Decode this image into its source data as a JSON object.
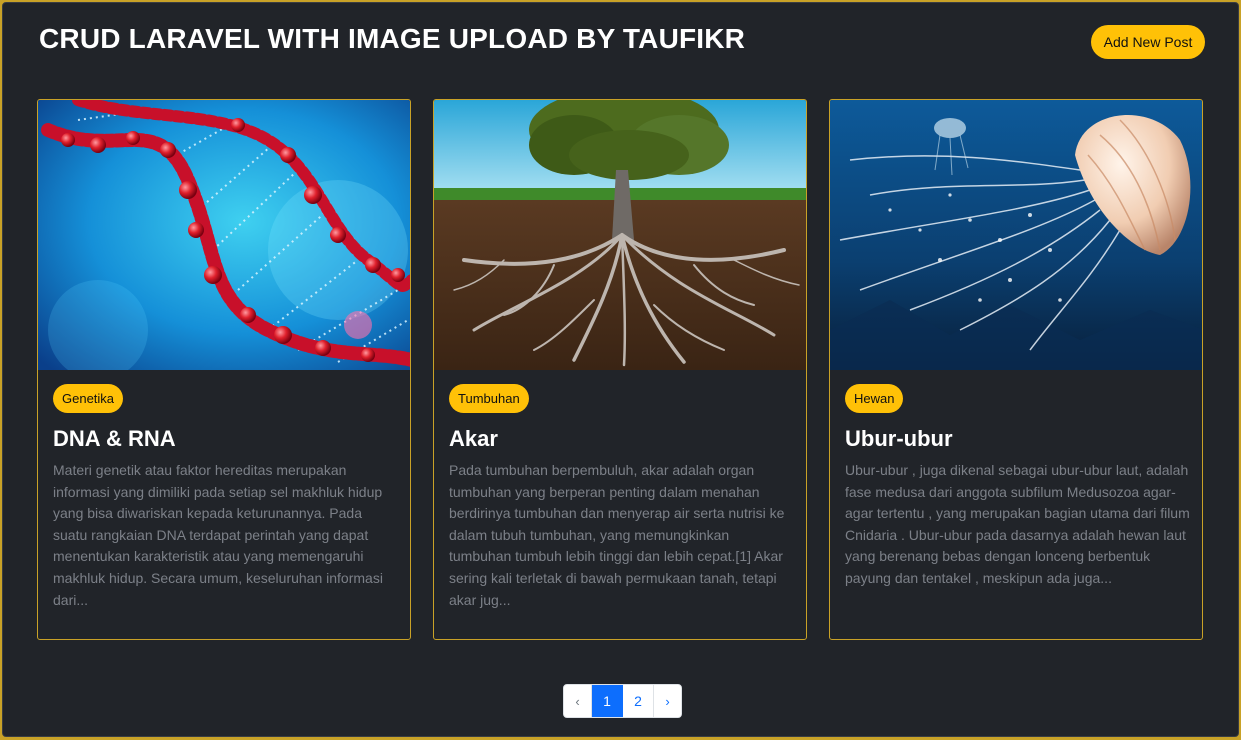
{
  "header": {
    "title": "CRUD LARAVEL WITH IMAGE UPLOAD BY TAUFIKR",
    "add_button": "Add New Post"
  },
  "posts": [
    {
      "category": "Genetika",
      "title": "DNA & RNA",
      "excerpt": "Materi genetik atau faktor hereditas merupakan informasi yang dimiliki pada setiap sel makhluk hidup yang bisa diwariskan kepada keturunannya. Pada suatu rangkaian DNA terdapat perintah yang dapat menentukan karakteristik atau yang memengaruhi makhluk hidup. Secara umum, keseluruhan informasi dari...",
      "image": "dna-helix-image"
    },
    {
      "category": "Tumbuhan",
      "title": "Akar",
      "excerpt": "Pada tumbuhan berpembuluh, akar adalah organ tumbuhan yang berperan penting dalam menahan berdirinya tumbuhan dan menyerap air serta nutrisi ke dalam tubuh tumbuhan, yang memungkinkan tumbuhan tumbuh lebih tinggi dan lebih cepat.[1] Akar sering kali terletak di bawah permukaan tanah, tetapi akar jug...",
      "image": "tree-roots-image"
    },
    {
      "category": "Hewan",
      "title": "Ubur-ubur",
      "excerpt": "Ubur-ubur , juga dikenal sebagai ubur-ubur laut, adalah fase medusa dari anggota subfilum Medusozoa agar-agar tertentu , yang merupakan bagian utama dari filum Cnidaria . Ubur-ubur pada dasarnya adalah hewan laut yang berenang bebas dengan lonceng berbentuk payung dan tentakel , meskipun ada juga...",
      "image": "jellyfish-image"
    }
  ],
  "pagination": {
    "prev": "‹",
    "pages": [
      "1",
      "2"
    ],
    "active": "1",
    "next": "›"
  },
  "colors": {
    "accent": "#ffc107",
    "background": "#212429",
    "active_page": "#0d6efd"
  }
}
